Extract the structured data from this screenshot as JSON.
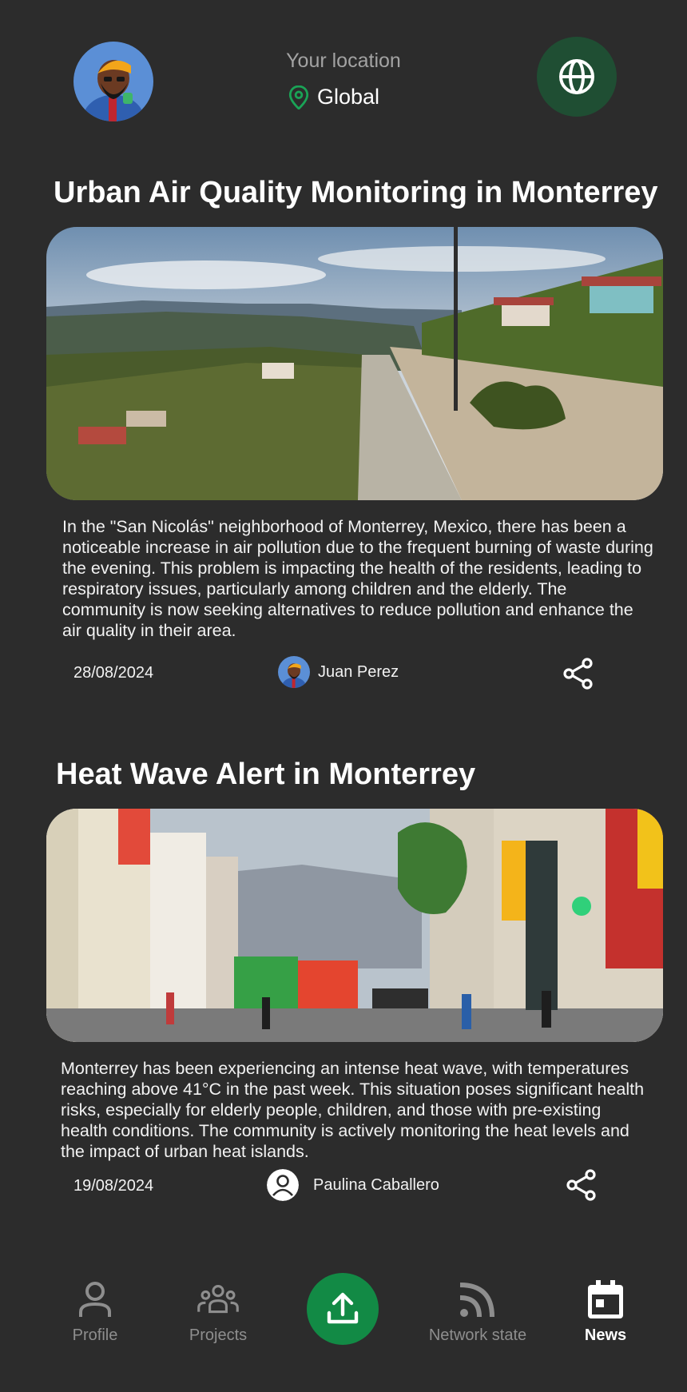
{
  "header": {
    "location_label": "Your location",
    "location_value": "Global",
    "colors": {
      "pin": "#1aa356",
      "globe_bg": "#1f4e33"
    },
    "icons": {
      "pin": "map-pin-icon",
      "globe": "globe-icon"
    }
  },
  "articles": [
    {
      "title": "Urban Air Quality Monitoring in Monterrey",
      "body": "In the \"San Nicolás\" neighborhood of Monterrey, Mexico, there has been a noticeable increase in air pollution due to the frequent burning of waste during the evening. This problem is impacting the health of the residents, leading to respiratory issues, particularly among children and the elderly. The community is now seeking alternatives to reduce pollution and enhance the air quality in their area.",
      "date": "28/08/2024",
      "author": "Juan Perez"
    },
    {
      "title": "Heat Wave Alert in Monterrey",
      "body": "Monterrey has been experiencing an intense heat wave, with temperatures reaching above 41°C in the past week. This situation poses significant health risks, especially for elderly people, children, and those with pre-existing health conditions. The community is actively monitoring the heat levels and the impact of urban heat islands.",
      "date": "19/08/2024",
      "author": "Paulina Caballero"
    }
  ],
  "nav": {
    "items": [
      {
        "label": "Profile",
        "icon": "person-icon"
      },
      {
        "label": "Projects",
        "icon": "group-icon"
      },
      {
        "label": "Network state",
        "icon": "rss-icon"
      },
      {
        "label": "News",
        "icon": "calendar-icon"
      }
    ],
    "active": "News",
    "upload_icon": "upload-icon",
    "upload_color": "#128a45"
  }
}
